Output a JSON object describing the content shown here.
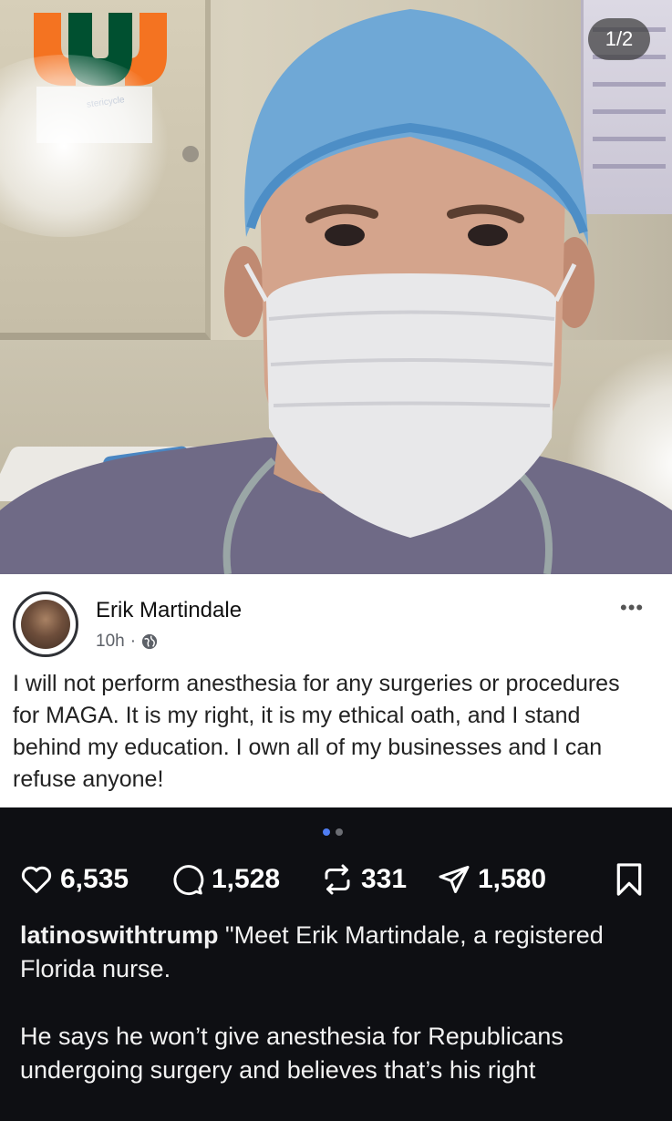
{
  "photo": {
    "counter_badge": "1/2",
    "sign_text": "stericycle"
  },
  "post": {
    "author": "Erik Martindale",
    "time": "10h",
    "separator": "·",
    "more": "•••",
    "body": "I will not perform anesthesia for any surgeries or procedures for MAGA. It is my right, it is my ethical oath, and I stand behind my education. I own all of my businesses and I can refuse anyone!"
  },
  "carousel": {
    "total": 2,
    "active": 1
  },
  "actions": {
    "likes": "6,535",
    "comments": "1,528",
    "reposts": "331",
    "shares": "1,580"
  },
  "caption": {
    "username": "latinoswithtrump",
    "text1": " \"Meet Erik Martindale, a registered Florida nurse.",
    "text2": "He says he won’t give anesthesia for Republicans undergoing surgery and believes that’s his right"
  },
  "colors": {
    "background": "#0e0f13",
    "accent_dot": "#4f7df2",
    "logo_orange": "#f47321",
    "logo_green": "#005030"
  }
}
